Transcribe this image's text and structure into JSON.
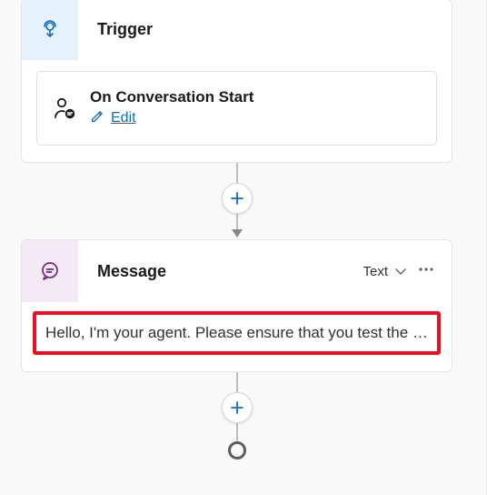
{
  "trigger": {
    "header_title": "Trigger",
    "event_title": "On Conversation Start",
    "edit_label": "Edit"
  },
  "message": {
    "header_title": "Message",
    "type_label": "Text",
    "body_text": "Hello, I'm your agent. Please ensure that you test the agent workflow."
  },
  "icons": {
    "trigger": "trigger-broadcast-icon",
    "event": "person-chat-icon",
    "edit_pencil": "pencil-icon",
    "message": "chat-icon",
    "chevron_down": "chevron-down-icon",
    "more": "more-ellipsis-icon",
    "add": "plus-icon"
  },
  "colors": {
    "accent": "#0f6cbd",
    "trigger_bg": "#e6f2fb",
    "message_bg": "#f2ebf3",
    "highlight_border": "#e81123"
  }
}
